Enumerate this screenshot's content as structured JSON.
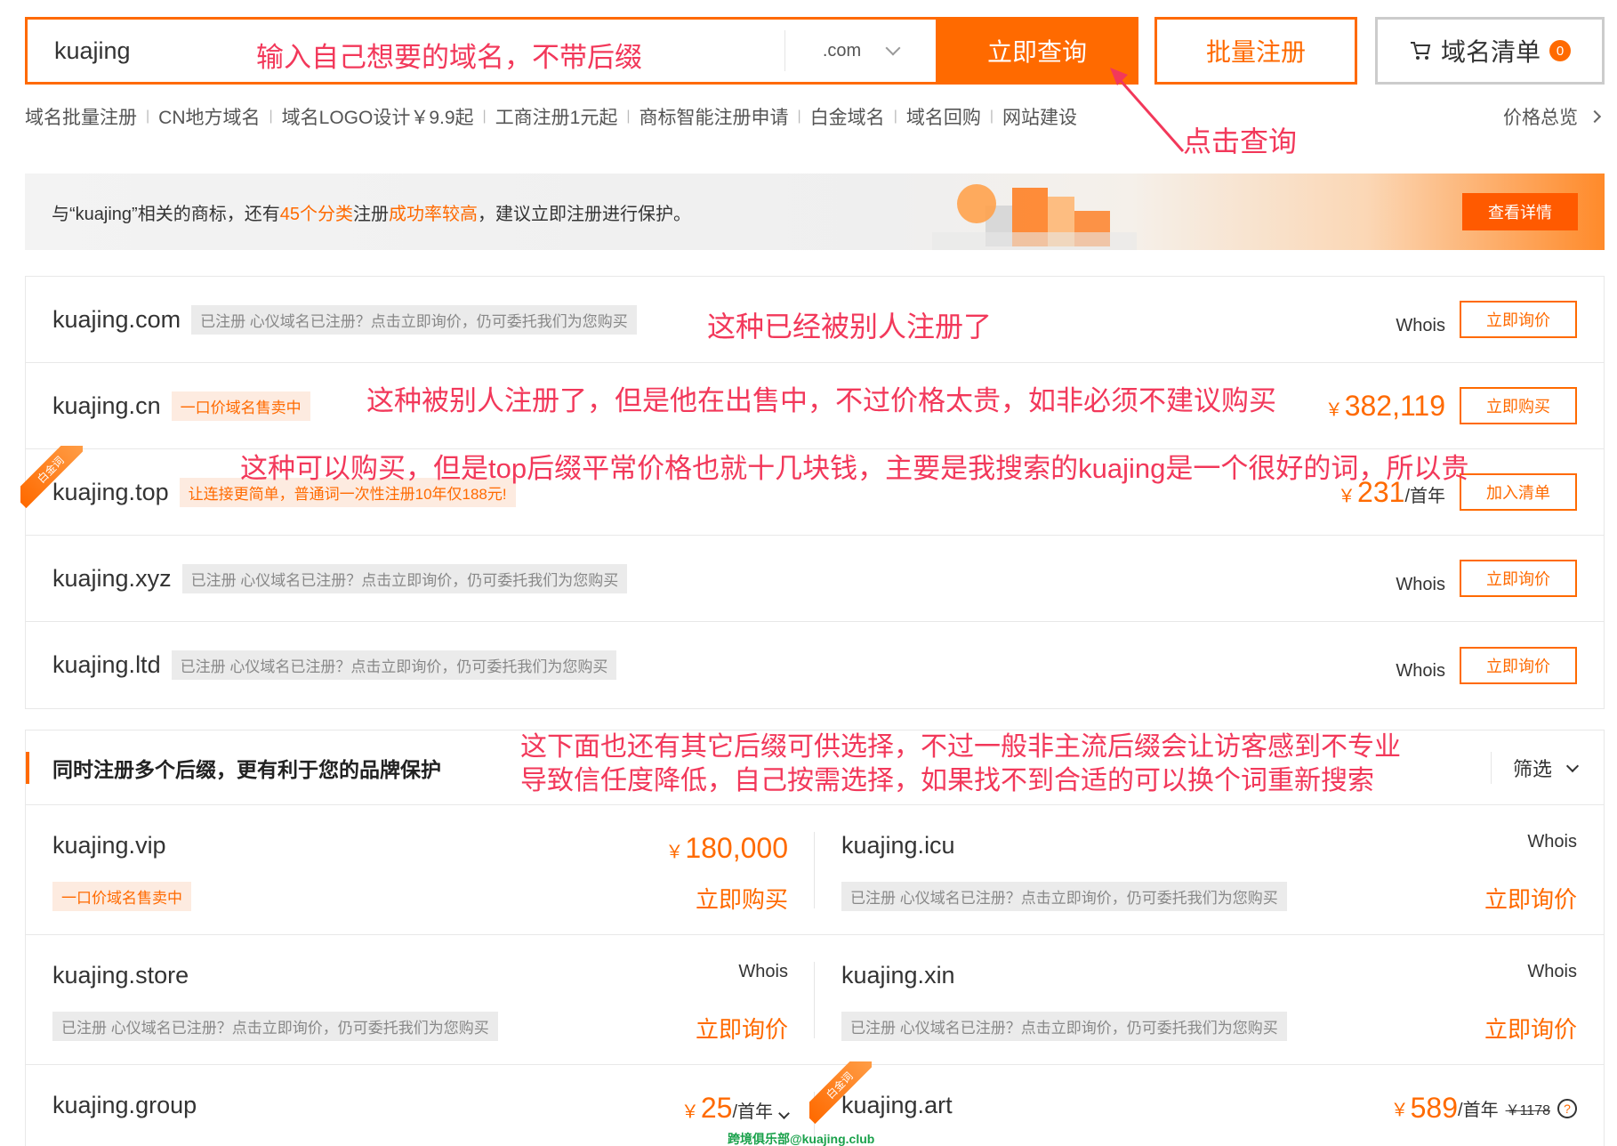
{
  "search": {
    "value": "kuajing",
    "suffix": ".com",
    "query_button": "立即查询",
    "batch_button": "批量注册",
    "cart_label": "域名清单",
    "cart_count": "0"
  },
  "quick_links": [
    "域名批量注册",
    "CN地方域名",
    "域名LOGO设计￥9.9起",
    "工商注册1元起",
    "商标智能注册申请",
    "白金域名",
    "域名回购",
    "网站建设"
  ],
  "price_overview": "价格总览",
  "banner": {
    "text_1": "与“kuajing”相关的商标，还有",
    "text_highlight_1": "45个分类",
    "text_2": "注册",
    "text_highlight_2": "成功率较高",
    "text_3": "，建议立即注册进行保护。",
    "button": "查看详情"
  },
  "results": [
    {
      "domain": "kuajing.com",
      "tag": "已注册 心仪域名已注册？点击立即询价，仍可委托我们为您购买",
      "tag_type": "gray",
      "whois": "Whois",
      "button": "立即询价"
    },
    {
      "domain": "kuajing.cn",
      "tag": "一口价域名售卖中",
      "tag_type": "orange",
      "price": "382,119",
      "button": "立即购买"
    },
    {
      "domain": "kuajing.top",
      "tag": "让连接更简单，普通词一次性注册10年仅188元!",
      "tag_type": "orange",
      "ribbon": "白金词",
      "price": "231",
      "price_unit": "/首年",
      "button": "加入清单"
    },
    {
      "domain": "kuajing.xyz",
      "tag": "已注册 心仪域名已注册？点击立即询价，仍可委托我们为您购买",
      "tag_type": "gray",
      "whois": "Whois",
      "button": "立即询价"
    },
    {
      "domain": "kuajing.ltd",
      "tag": "已注册 心仪域名已注册？点击立即询价，仍可委托我们为您购买",
      "tag_type": "gray",
      "whois": "Whois",
      "button": "立即询价"
    }
  ],
  "multi": {
    "title": "同时注册多个后缀，更有利于您的品牌保护",
    "filter": "筛选",
    "cells": [
      {
        "domain": "kuajing.vip",
        "price": "180,000",
        "tag": "一口价域名售卖中",
        "tag_type": "orange",
        "action": "立即购买"
      },
      {
        "domain": "kuajing.icu",
        "whois": "Whois",
        "tag": "已注册 心仪域名已注册？点击立即询价，仍可委托我们为您购买",
        "tag_type": "gray",
        "action": "立即询价"
      },
      {
        "domain": "kuajing.store",
        "whois": "Whois",
        "tag": "已注册 心仪域名已注册？点击立即询价，仍可委托我们为您购买",
        "tag_type": "gray",
        "action": "立即询价"
      },
      {
        "domain": "kuajing.xin",
        "whois": "Whois",
        "tag": "已注册 心仪域名已注册？点击立即询价，仍可委托我们为您购买",
        "tag_type": "gray",
        "action": "立即询价"
      },
      {
        "domain": "kuajing.group",
        "price": "25",
        "price_unit": "/首年"
      },
      {
        "domain": "kuajing.art",
        "price": "589",
        "price_unit": "/首年",
        "old_price": "￥1178",
        "ribbon": "白金词"
      }
    ]
  },
  "annotations": {
    "search_hint": "输入自己想要的域名，不带后缀",
    "click_query": "点击查询",
    "registered": "这种已经被别人注册了",
    "for_sale": "这种被别人注册了，但是他在出售中，不过价格太贵，如非必须不建议购买",
    "buyable": "这种可以购买，但是top后缀平常价格也就十几块钱，主要是我搜索的kuajing是一个很好的词，所以贵",
    "other_line1": "这下面也还有其它后缀可供选择，不过一般非主流后缀会让访客感到不专业",
    "other_line2": "导致信任度降低，自己按需选择，如果找不到合适的可以换个词重新搜索"
  },
  "currency": "￥",
  "watermark": "跨境俱乐部@kuajing.club",
  "colors": {
    "accent": "#ff6a00",
    "annotation": "#f2385a"
  }
}
